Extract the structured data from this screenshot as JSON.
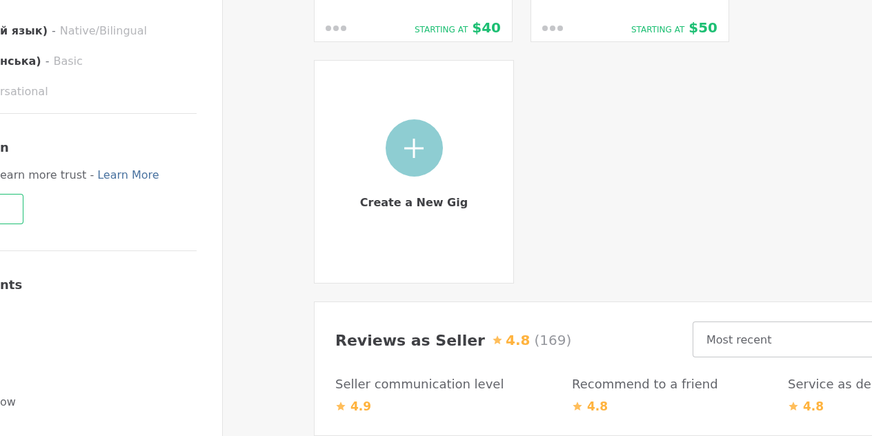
{
  "sidebar": {
    "languages": [
      {
        "name": "й язык)",
        "separator": "-",
        "level": "Native/Bilingual"
      },
      {
        "name": "нська)",
        "separator": "-",
        "level": "Basic"
      },
      {
        "level": "rsational"
      }
    ],
    "verification": {
      "heading": "n",
      "text": "earn more trust -",
      "link": "Learn More"
    },
    "accounts": {
      "heading": "nts"
    },
    "footer_text": "ow"
  },
  "gigs": [
    {
      "price_label": "STARTING AT",
      "price": "$40"
    },
    {
      "price_label": "STARTING AT",
      "price": "$50"
    }
  ],
  "create_gig": {
    "label": "Create a New Gig"
  },
  "reviews": {
    "title": "Reviews as Seller",
    "rating": "4.8",
    "count": "(169)",
    "sort": "Most recent",
    "breakdown": [
      {
        "label": "Seller communication level",
        "rating": "4.9"
      },
      {
        "label": "Recommend to a friend",
        "rating": "4.8"
      },
      {
        "label": "Service as de",
        "rating": "4.8"
      }
    ]
  }
}
